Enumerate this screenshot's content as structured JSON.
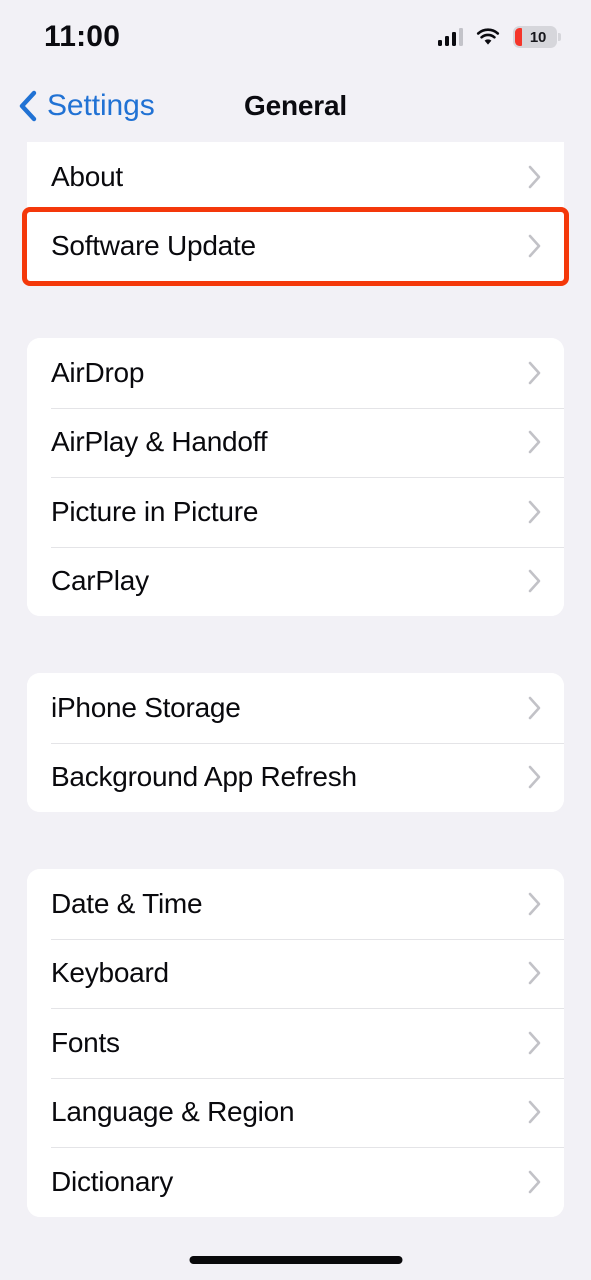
{
  "status_bar": {
    "time": "11:00",
    "cellular_icon": "cellular-bars-icon",
    "cellular_bars_filled": 3,
    "cellular_bars_total": 4,
    "wifi_icon": "wifi-icon",
    "battery_icon": "battery-icon",
    "battery_level": "10",
    "battery_low": true,
    "battery_fill_color": "#f5352a"
  },
  "nav": {
    "back_label": "Settings",
    "back_icon": "chevron-left-icon",
    "title": "General",
    "accent_color": "#2172d4"
  },
  "theme": {
    "background": "#f2f1f6",
    "card": "#ffffff",
    "separator": "#e4e4e7",
    "text": "#09090d",
    "chevron": "#c2c2c7",
    "highlight": "#f4380a"
  },
  "groups": [
    {
      "id": "group-system",
      "rows": [
        {
          "label": "About",
          "name": "about",
          "highlighted": false
        },
        {
          "label": "Software Update",
          "name": "software-update",
          "highlighted": true
        }
      ]
    },
    {
      "id": "group-connectivity",
      "rows": [
        {
          "label": "AirDrop",
          "name": "airdrop",
          "highlighted": false
        },
        {
          "label": "AirPlay & Handoff",
          "name": "airplay-handoff",
          "highlighted": false
        },
        {
          "label": "Picture in Picture",
          "name": "picture-in-picture",
          "highlighted": false
        },
        {
          "label": "CarPlay",
          "name": "carplay",
          "highlighted": false
        }
      ]
    },
    {
      "id": "group-storage",
      "rows": [
        {
          "label": "iPhone Storage",
          "name": "iphone-storage",
          "highlighted": false
        },
        {
          "label": "Background App Refresh",
          "name": "background-app-refresh",
          "highlighted": false
        }
      ]
    },
    {
      "id": "group-localization",
      "rows": [
        {
          "label": "Date & Time",
          "name": "date-time",
          "highlighted": false
        },
        {
          "label": "Keyboard",
          "name": "keyboard",
          "highlighted": false
        },
        {
          "label": "Fonts",
          "name": "fonts",
          "highlighted": false
        },
        {
          "label": "Language & Region",
          "name": "language-region",
          "highlighted": false
        },
        {
          "label": "Dictionary",
          "name": "dictionary",
          "highlighted": false
        }
      ]
    }
  ],
  "home_indicator": "home-indicator"
}
